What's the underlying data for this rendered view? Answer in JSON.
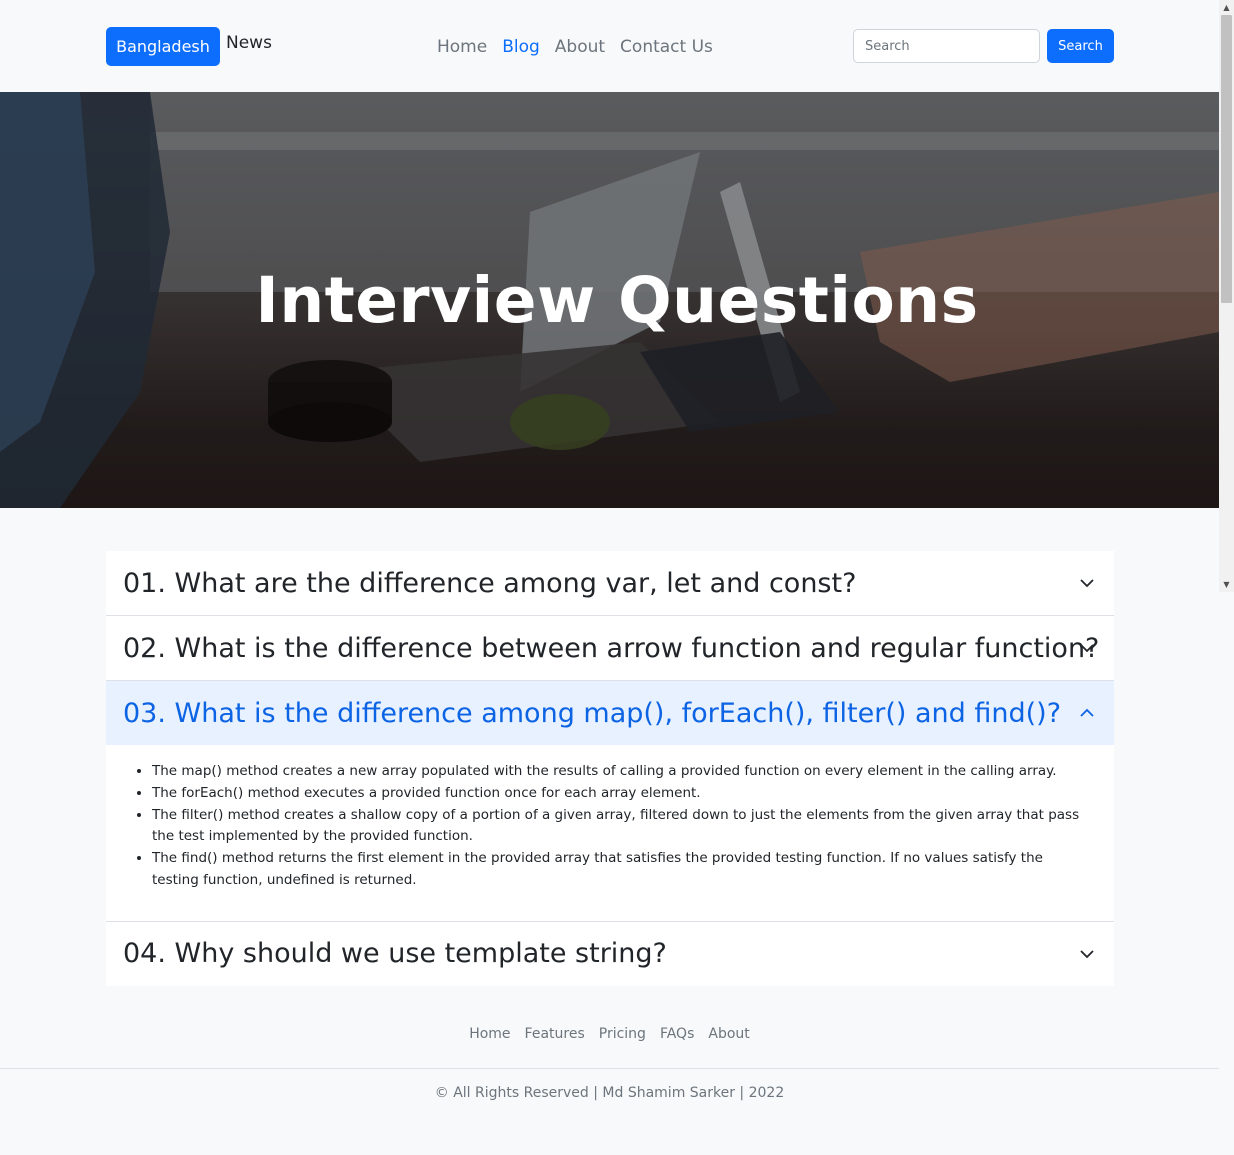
{
  "navbar": {
    "brand_button": "Bangladesh",
    "brand_text": "News",
    "links": [
      "Home",
      "Blog",
      "About",
      "Contact Us"
    ],
    "active_link": "Blog",
    "search_placeholder": "Search",
    "search_button": "Search"
  },
  "hero": {
    "title": "Interview Questions"
  },
  "accordion": {
    "items": [
      {
        "title": "01. What are the difference among var, let and const?",
        "expanded": false
      },
      {
        "title": "02. What is the difference between arrow function and regular function?",
        "expanded": false
      },
      {
        "title": "03. What is the difference among map(), forEach(), filter() and find()?",
        "expanded": true,
        "points": [
          "The map() method creates a new array populated with the results of calling a provided function on every element in the calling array.",
          "The forEach() method executes a provided function once for each array element.",
          "The filter() method creates a shallow copy of a portion of a given array, filtered down to just the elements from the given array that pass the test implemented by the provided function.",
          "The find() method returns the first element in the provided array that satisfies the provided testing function. If no values satisfy the testing function, undefined is returned."
        ]
      },
      {
        "title": "04. Why should we use template string?",
        "expanded": false
      }
    ]
  },
  "footer": {
    "links": [
      "Home",
      "Features",
      "Pricing",
      "FAQs",
      "About"
    ],
    "copyright": "© All Rights Reserved | Md Shamim Sarker | 2022"
  },
  "colors": {
    "primary": "#0d6efd",
    "accordion_open_bg": "#e7f1ff",
    "accordion_open_text": "#0c63e4",
    "muted": "#6c757d"
  },
  "icons": [
    "chevron-down-icon",
    "chevron-up-icon"
  ]
}
